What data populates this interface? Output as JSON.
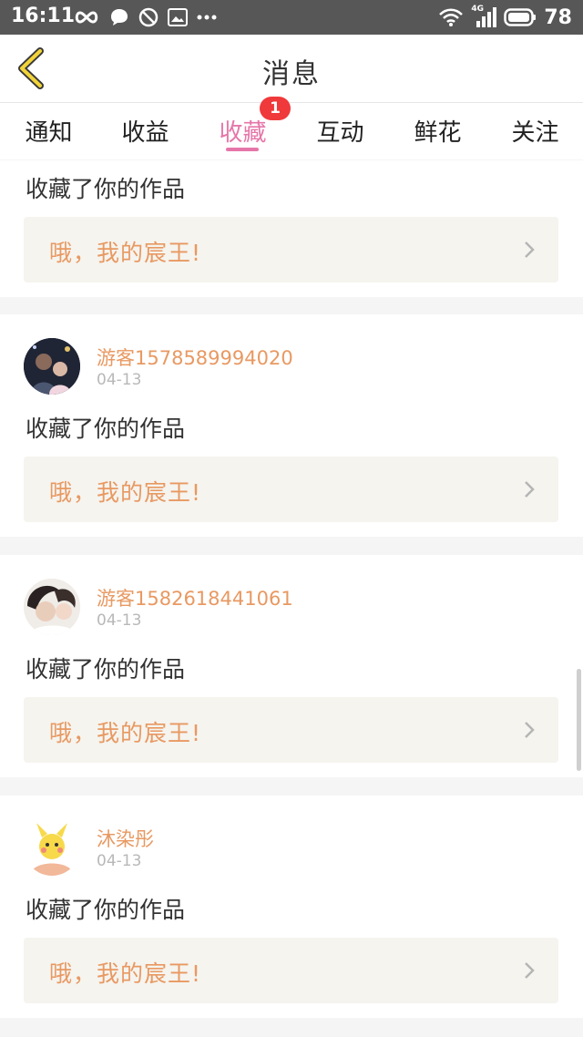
{
  "status_bar": {
    "time": "16:11",
    "network": "4G",
    "battery": "78",
    "icons_left": [
      "infinity-icon",
      "chat-bubble-icon",
      "no-disturb-icon",
      "image-icon",
      "more-dots-icon"
    ],
    "icons_right": [
      "wifi-icon",
      "signal-icon",
      "battery-icon"
    ]
  },
  "header": {
    "title": "消息"
  },
  "tabs": [
    {
      "label": "通知"
    },
    {
      "label": "收益"
    },
    {
      "label": "收藏",
      "active": true,
      "badge": "1"
    },
    {
      "label": "互动"
    },
    {
      "label": "鲜花"
    },
    {
      "label": "关注"
    }
  ],
  "messages": [
    {
      "user": "",
      "date": "",
      "text": "收藏了你的作品",
      "work_title": "哦，我的宸王!"
    },
    {
      "user": "游客1578589994020",
      "date": "04-13",
      "text": "收藏了你的作品",
      "work_title": "哦，我的宸王!"
    },
    {
      "user": "游客1582618441061",
      "date": "04-13",
      "text": "收藏了你的作品",
      "work_title": "哦，我的宸王!"
    },
    {
      "user": "沐染彤",
      "date": "04-13",
      "text": "收藏了你的作品",
      "work_title": "哦，我的宸王!"
    }
  ],
  "colors": {
    "accent": "#e676a9",
    "username": "#e89962",
    "badge": "#f0393a",
    "status_bar": "#575757"
  }
}
